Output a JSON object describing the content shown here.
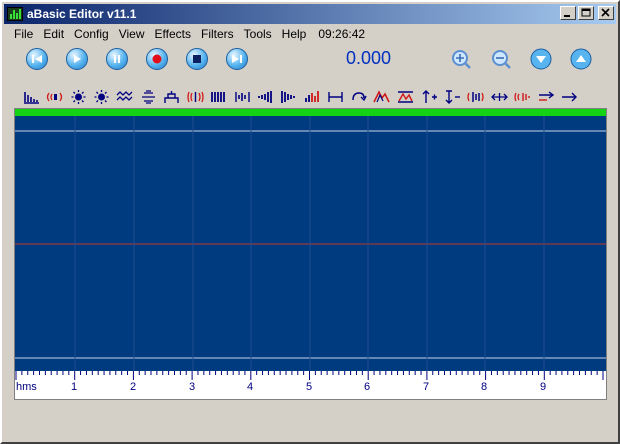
{
  "window": {
    "title": "aBasic Editor v11.1",
    "controls": [
      "minimize",
      "maximize",
      "close"
    ]
  },
  "menu": {
    "items": [
      "File",
      "Edit",
      "Config",
      "View",
      "Effects",
      "Filters",
      "Tools",
      "Help"
    ],
    "clock": "09:26:42"
  },
  "transport": {
    "buttons": [
      {
        "name": "skip-to-start",
        "icon": "skip-back-icon"
      },
      {
        "name": "play",
        "icon": "play-icon"
      },
      {
        "name": "pause",
        "icon": "pause-icon"
      },
      {
        "name": "record",
        "icon": "record-icon"
      },
      {
        "name": "stop",
        "icon": "stop-icon"
      },
      {
        "name": "skip-to-end",
        "icon": "skip-forward-icon"
      }
    ],
    "counter": "0.000"
  },
  "zoom": {
    "buttons": [
      {
        "name": "zoom-in",
        "icon": "zoom-in-icon"
      },
      {
        "name": "zoom-out",
        "icon": "zoom-out-icon"
      },
      {
        "name": "zoom-vertical-down",
        "icon": "chevron-down-icon"
      },
      {
        "name": "zoom-vertical-up",
        "icon": "chevron-up-icon"
      }
    ]
  },
  "effects_toolbar": {
    "icons": [
      "spectrum-icon",
      "echo-icon",
      "brightness-icon",
      "brightness-alt-icon",
      "wave-icon",
      "equalizer-icon",
      "filter-icon",
      "reverb-icon",
      "bars-icon",
      "mirror-icon",
      "fade-in-icon",
      "fade-out-icon",
      "level-meter-icon",
      "range-icon",
      "loop-icon",
      "peak-icon",
      "normalize-icon",
      "amplify-up-icon",
      "amplify-down-icon",
      "stereo-icon",
      "expand-icon",
      "echo-alt-icon",
      "shift-right-icon",
      "arrow-right-icon"
    ]
  },
  "timeline": {
    "unit_label": "hms",
    "labels": [
      "1",
      "2",
      "3",
      "4",
      "5",
      "6",
      "7",
      "8",
      "9"
    ]
  },
  "colors": {
    "title_gradient_start": "#0a246a",
    "wave_background": "#003a7f",
    "selection_bar": "#14d214",
    "center_line": "#c0392b",
    "grid_line": "#1f4f8f",
    "transport_button": "#57b4ef"
  }
}
